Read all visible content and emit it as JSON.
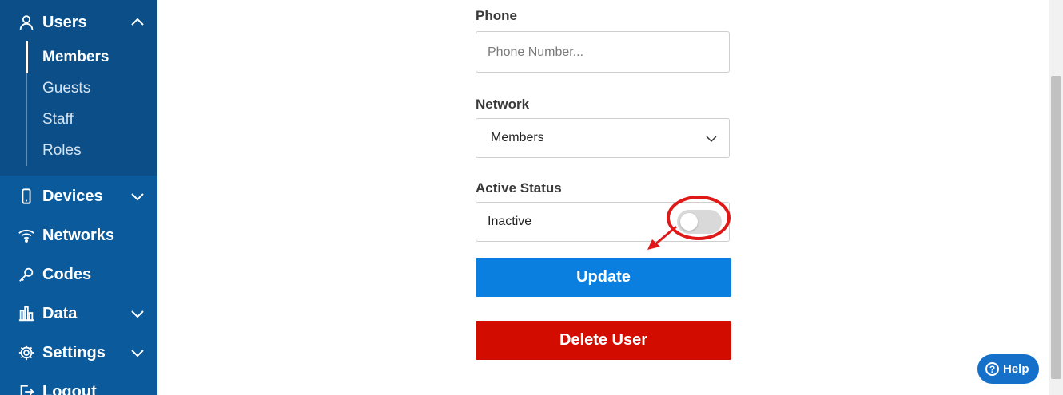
{
  "sidebar": {
    "users": {
      "label": "Users",
      "icon": "user-icon"
    },
    "sub_items": [
      {
        "label": "Members",
        "active": true
      },
      {
        "label": "Guests",
        "active": false
      },
      {
        "label": "Staff",
        "active": false
      },
      {
        "label": "Roles",
        "active": false
      }
    ],
    "items": [
      {
        "label": "Devices",
        "icon": "phone-icon",
        "expandable": true
      },
      {
        "label": "Networks",
        "icon": "wifi-icon",
        "expandable": false
      },
      {
        "label": "Codes",
        "icon": "key-icon",
        "expandable": false
      },
      {
        "label": "Data",
        "icon": "bar-chart-icon",
        "expandable": true
      },
      {
        "label": "Settings",
        "icon": "gear-icon",
        "expandable": true
      },
      {
        "label": "Logout",
        "icon": "logout-icon",
        "expandable": false
      }
    ]
  },
  "form": {
    "phone": {
      "label": "Phone",
      "placeholder": "Phone Number...",
      "value": ""
    },
    "network": {
      "label": "Network",
      "selected": "Members"
    },
    "active_status": {
      "label": "Active Status",
      "value": "Inactive",
      "enabled": false
    },
    "update_label": "Update",
    "delete_label": "Delete User"
  },
  "help": {
    "label": "Help",
    "icon_glyph": "?"
  },
  "colors": {
    "sidebar": "#0a5a9c",
    "sidebar_group": "#0b4e88",
    "update": "#0a7fe0",
    "delete": "#d20d00",
    "annotation": "#e01818",
    "help": "#1570c9"
  }
}
